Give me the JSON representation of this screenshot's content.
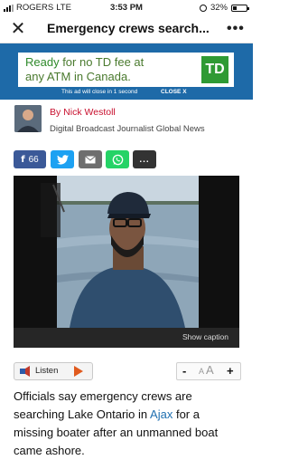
{
  "status_bar": {
    "carrier": "ROGERS",
    "network": "LTE",
    "time": "3:53 PM",
    "battery": "32%",
    "battery_level": 0.32
  },
  "nav": {
    "close_icon": "close-icon",
    "title": "Emergency crews search...",
    "more_icon": "more-dots-icon"
  },
  "ad": {
    "line1_highlight": "Ready",
    "line1_rest": " for no TD fee at",
    "line2": "any ATM in Canada.",
    "logo_text": "TD",
    "closing_note": "This ad will close in 1 second",
    "close_label": "CLOSE X",
    "colors": {
      "frame": "#1e6aa8",
      "brand_green": "#2f9a34"
    }
  },
  "author": {
    "byline": "By Nick Westoll",
    "role": "Digital Broadcast Journalist  Global News"
  },
  "share": {
    "facebook_count": "66",
    "more_label": "..."
  },
  "image": {
    "caption_button": "Show caption"
  },
  "listen": {
    "label": "Listen"
  },
  "font_controls": {
    "decrease": "-",
    "small_a": "A",
    "large_a": "A",
    "increase": "+"
  },
  "article": {
    "lead_before": "Officials say emergency crews are searching Lake Ontario in ",
    "lead_link": "Ajax",
    "lead_after": " for a missing boater after an unmanned boat came ashore."
  }
}
